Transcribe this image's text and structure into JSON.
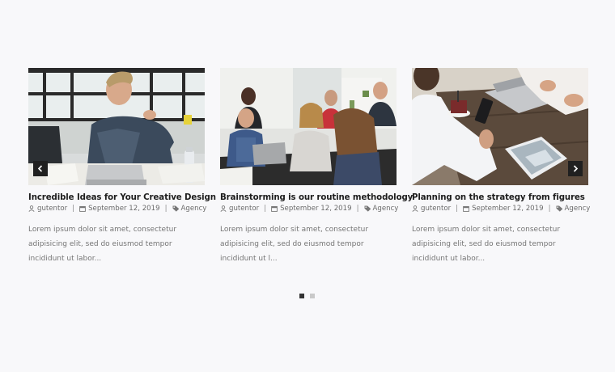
{
  "posts": [
    {
      "title": "Incredible Ideas for Your Creative Design",
      "author": "gutentor",
      "date": "September 12, 2019",
      "category": "Agency",
      "excerpt": "Lorem ipsum dolor sit amet, consectetur adipisicing elit, sed do eiusmod tempor incididunt ut labor..."
    },
    {
      "title": "Brainstorming is our routine methodology",
      "author": "gutentor",
      "date": "September 12, 2019",
      "category": "Agency",
      "excerpt": "Lorem ipsum dolor sit amet, consectetur adipisicing elit, sed do eiusmod tempor incididunt ut l..."
    },
    {
      "title": "Planning on the strategy from figures",
      "author": "gutentor",
      "date": "September 12, 2019",
      "category": "Agency",
      "excerpt": "Lorem ipsum dolor sit amet, consectetur adipisicing elit, sed do eiusmod tempor incididunt ut labor..."
    }
  ],
  "meta_separator": "|",
  "navigation": {
    "prev_icon": "chevron-left-icon",
    "next_icon": "chevron-right-icon"
  },
  "pagination": {
    "pages": 2,
    "active_page": 1
  },
  "colors": {
    "page_background": "#f8f8fa",
    "title": "#1d1d1d",
    "meta": "#6b6b6b",
    "excerpt": "#757575",
    "nav_button": "#202020",
    "dot_active": "#333333",
    "dot_inactive": "#c9c9c9"
  }
}
